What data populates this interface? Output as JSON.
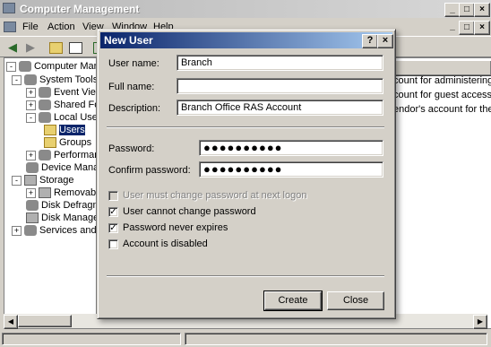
{
  "main_window": {
    "title": "Computer Management",
    "menu": [
      "File",
      "Action",
      "View",
      "Window",
      "Help"
    ]
  },
  "tree": [
    {
      "label": "Computer Managem",
      "expander": "-",
      "icon": "computer-icon"
    },
    {
      "label": "System Tools",
      "expander": "-",
      "icon": "tools-icon"
    },
    {
      "label": "Event Viewer",
      "expander": "+",
      "icon": "event-viewer-icon"
    },
    {
      "label": "Shared Folde",
      "expander": "+",
      "icon": "shared-folder-icon"
    },
    {
      "label": "Local Users a",
      "expander": "-",
      "icon": "users-icon"
    },
    {
      "label": "Users",
      "expander": "",
      "icon": "folder-icon",
      "selected": true
    },
    {
      "label": "Groups",
      "expander": "",
      "icon": "folder-icon"
    },
    {
      "label": "Performance",
      "expander": "+",
      "icon": "performance-icon"
    },
    {
      "label": "Device Mana",
      "expander": "",
      "icon": "device-manager-icon"
    },
    {
      "label": "Storage",
      "expander": "-",
      "icon": "storage-icon"
    },
    {
      "label": "Removable S",
      "expander": "+",
      "icon": "removable-storage-icon"
    },
    {
      "label": "Disk Defragn",
      "expander": "",
      "icon": "defrag-icon"
    },
    {
      "label": "Disk Manage",
      "expander": "",
      "icon": "disk-icon"
    },
    {
      "label": "Services and App",
      "expander": "+",
      "icon": "services-icon"
    }
  ],
  "list": {
    "column_header": "n",
    "rows": [
      "count for administering th",
      "count for guest access to",
      "endor's account for the H"
    ]
  },
  "dialog": {
    "title": "New User",
    "help_button": "?",
    "close_button": "×",
    "user_name_label": "User name:",
    "user_name_value": "Branch",
    "full_name_label": "Full name:",
    "full_name_value": "",
    "description_label": "Description:",
    "description_value": "Branch Office RAS Account",
    "password_label": "Password:",
    "password_value": "●●●●●●●●●●",
    "confirm_label": "Confirm password:",
    "confirm_value": "●●●●●●●●●●",
    "checkboxes": [
      {
        "label": "User must change password at next logon",
        "checked": false,
        "disabled": true
      },
      {
        "label": "User cannot change password",
        "checked": true,
        "disabled": false
      },
      {
        "label": "Password never expires",
        "checked": true,
        "disabled": false
      },
      {
        "label": "Account is disabled",
        "checked": false,
        "disabled": false
      }
    ],
    "create_button": "Create",
    "close_label": "Close"
  }
}
